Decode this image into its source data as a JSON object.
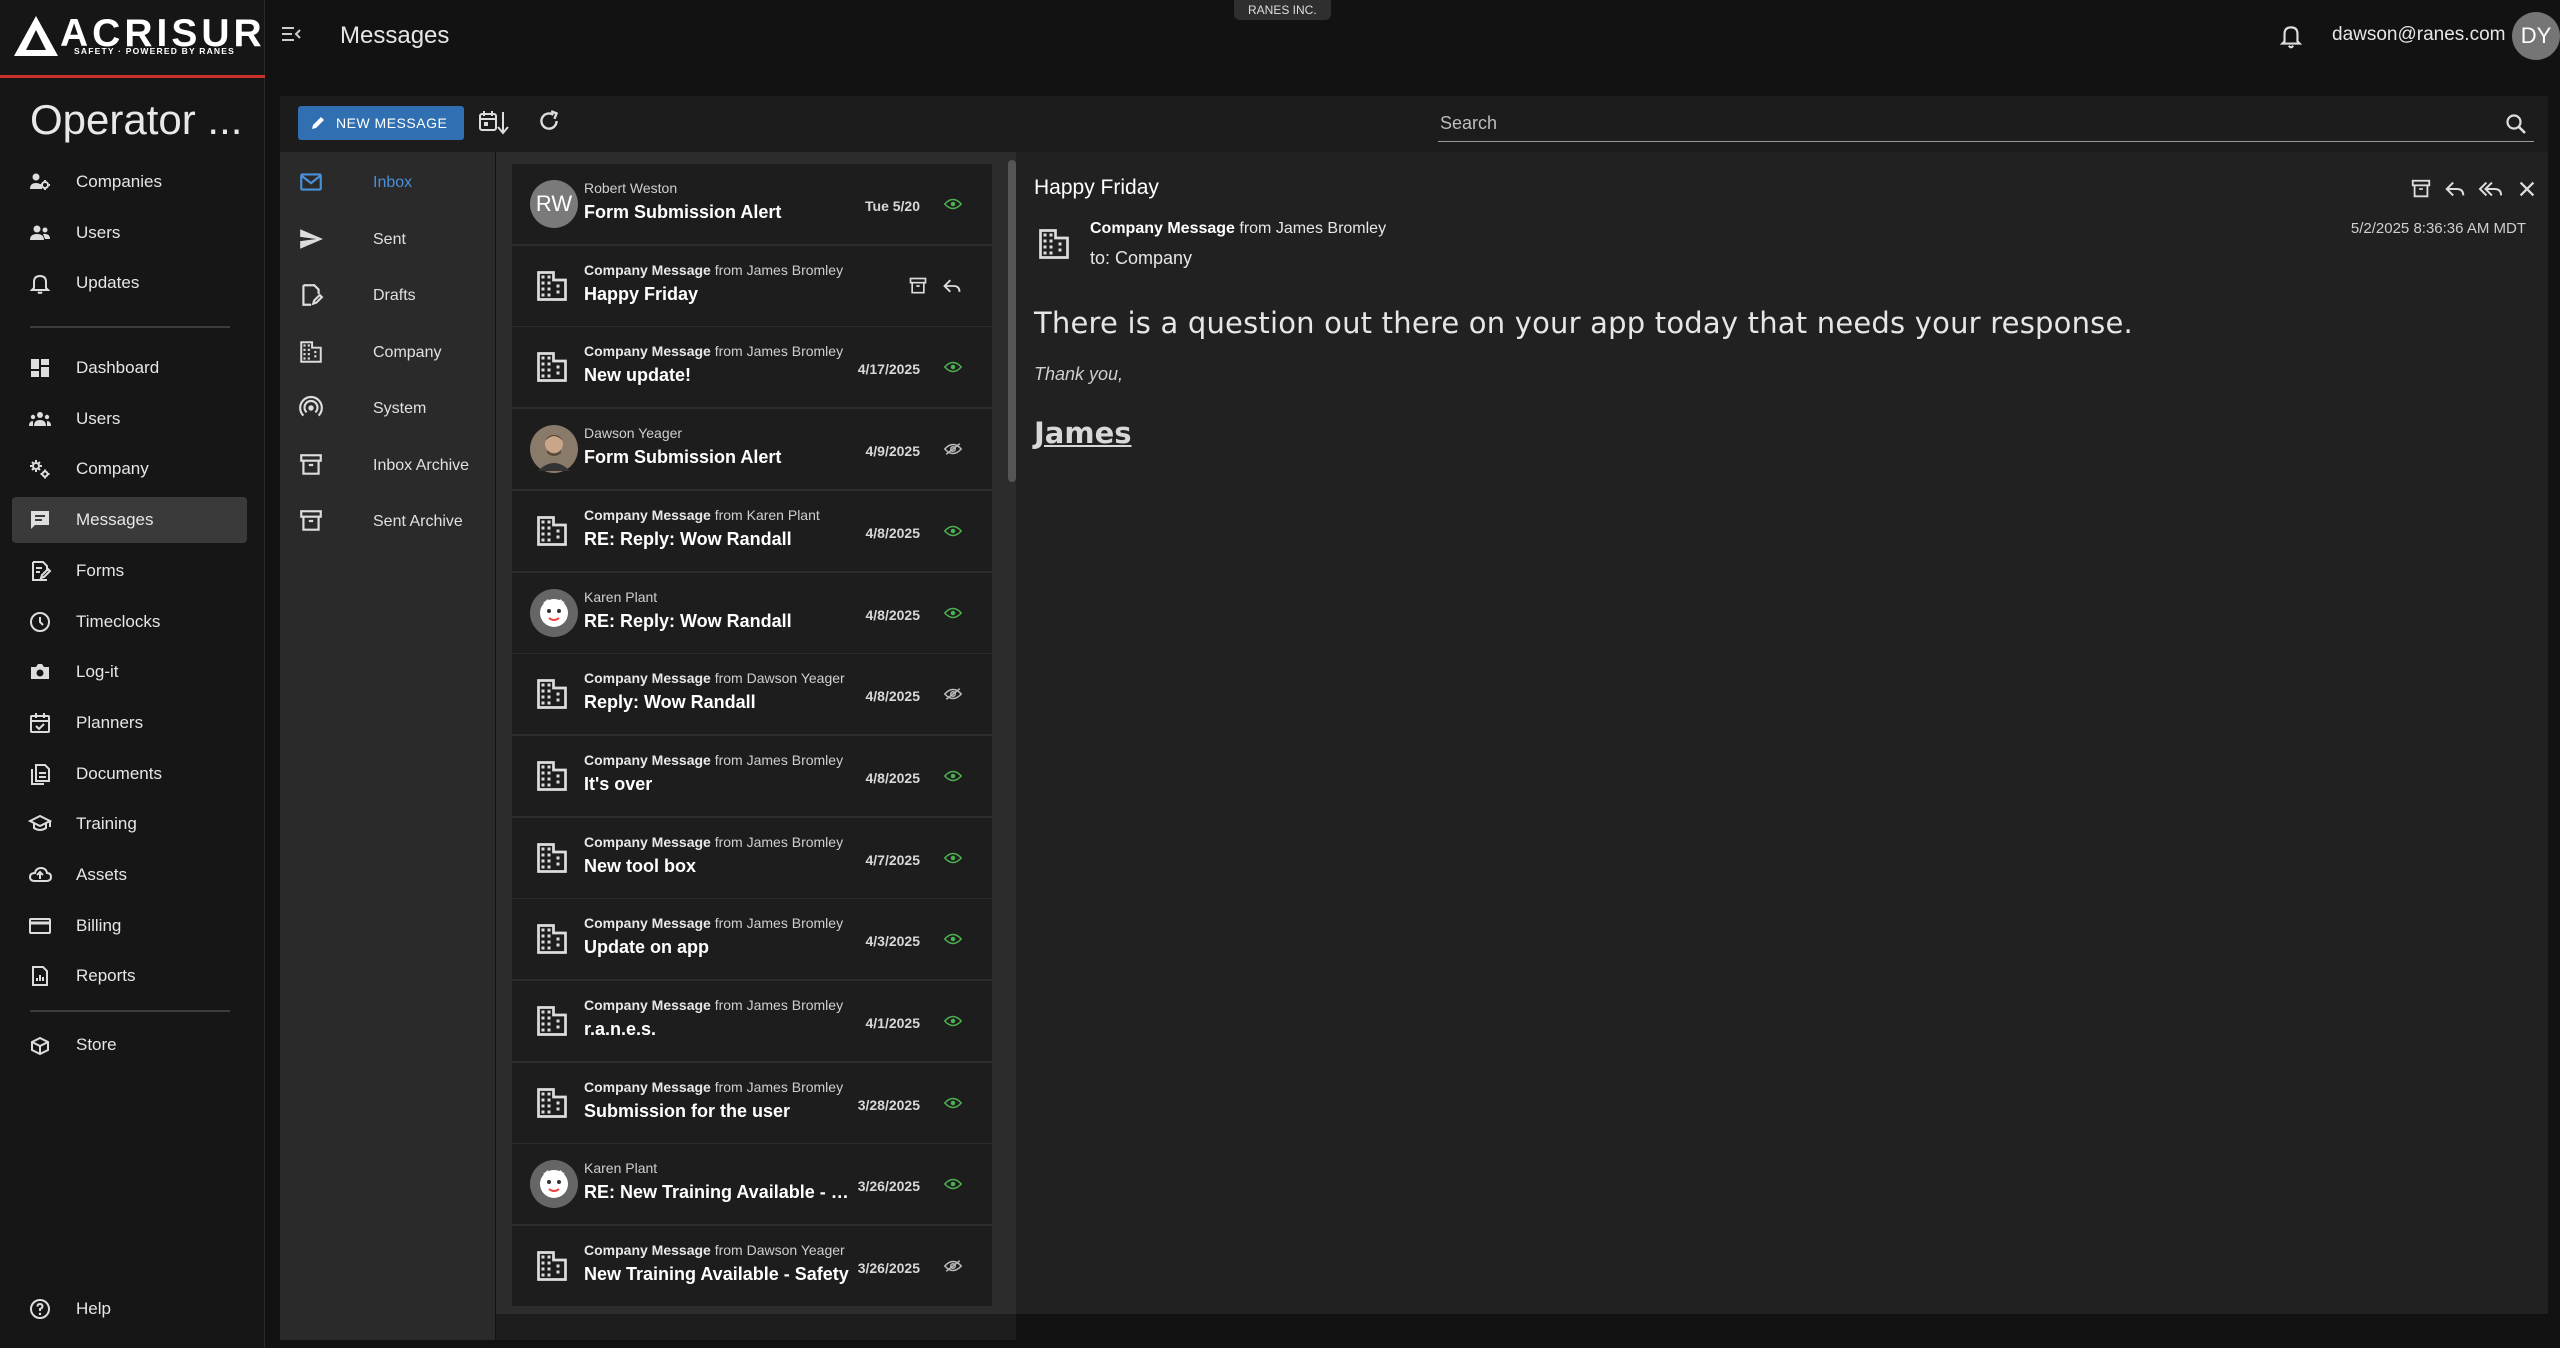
{
  "brand": {
    "name": "ACRISURE",
    "registered": "®",
    "tagline": "SAFETY · POWERED BY RANES"
  },
  "sidebar": {
    "org_title": "Operator ...",
    "group1": [
      {
        "label": "Companies",
        "icon": "companies-icon"
      },
      {
        "label": "Users",
        "icon": "users-icon"
      },
      {
        "label": "Updates",
        "icon": "bell-icon"
      }
    ],
    "group2": [
      {
        "label": "Dashboard",
        "icon": "dashboard-icon"
      },
      {
        "label": "Users",
        "icon": "users-group-icon"
      },
      {
        "label": "Company",
        "icon": "gears-icon"
      },
      {
        "label": "Messages",
        "icon": "message-icon",
        "active": true
      },
      {
        "label": "Forms",
        "icon": "forms-icon"
      },
      {
        "label": "Timeclocks",
        "icon": "clock-icon"
      },
      {
        "label": "Log-it",
        "icon": "camera-icon"
      },
      {
        "label": "Planners",
        "icon": "calendar-icon"
      },
      {
        "label": "Documents",
        "icon": "documents-icon"
      },
      {
        "label": "Training",
        "icon": "training-icon"
      },
      {
        "label": "Assets",
        "icon": "cloud-icon"
      },
      {
        "label": "Billing",
        "icon": "card-icon"
      },
      {
        "label": "Reports",
        "icon": "reports-icon"
      }
    ],
    "store": {
      "label": "Store",
      "icon": "store-icon"
    },
    "help": {
      "label": "Help",
      "icon": "help-icon"
    }
  },
  "header": {
    "title": "Messages",
    "org_badge": "RANES INC.",
    "user_email": "dawson@ranes.com",
    "user_initials": "DY"
  },
  "toolbar": {
    "new_message_label": "NEW MESSAGE",
    "search_placeholder": "Search"
  },
  "folders": [
    {
      "label": "Inbox",
      "icon": "mail-icon",
      "active": true
    },
    {
      "label": "Sent",
      "icon": "send-icon"
    },
    {
      "label": "Drafts",
      "icon": "drafts-icon"
    },
    {
      "label": "Company",
      "icon": "building-icon"
    },
    {
      "label": "System",
      "icon": "broadcast-icon"
    },
    {
      "label": "Inbox Archive",
      "icon": "archive-icon"
    },
    {
      "label": "Sent Archive",
      "icon": "archive-icon"
    }
  ],
  "messages": [
    {
      "type": "user",
      "initials": "RW",
      "from": "Robert Weston",
      "subject": "Form Submission Alert",
      "date": "Tue 5/20",
      "status": "read"
    },
    {
      "type": "company",
      "from_prefix": "Company Message",
      "from": " from James Bromley",
      "subject": "Happy Friday",
      "date": "",
      "status": "selected"
    },
    {
      "type": "company",
      "from_prefix": "Company Message",
      "from": " from James Bromley",
      "subject": "New update!",
      "date": "4/17/2025",
      "status": "read"
    },
    {
      "type": "photo",
      "from": "Dawson Yeager",
      "subject": "Form Submission Alert",
      "date": "4/9/2025",
      "status": "unread"
    },
    {
      "type": "company",
      "from_prefix": "Company Message",
      "from": " from Karen Plant",
      "subject": "RE: Reply: Wow Randall",
      "date": "4/8/2025",
      "status": "read"
    },
    {
      "type": "cartoon",
      "from": "Karen Plant",
      "subject": "RE: Reply: Wow Randall",
      "date": "4/8/2025",
      "status": "read"
    },
    {
      "type": "company",
      "from_prefix": "Company Message",
      "from": " from Dawson Yeager",
      "subject": "Reply: Wow Randall",
      "date": "4/8/2025",
      "status": "unread"
    },
    {
      "type": "company",
      "from_prefix": "Company Message",
      "from": " from James Bromley",
      "subject": "It's over",
      "date": "4/8/2025",
      "status": "read"
    },
    {
      "type": "company",
      "from_prefix": "Company Message",
      "from": " from James Bromley",
      "subject": "New tool box",
      "date": "4/7/2025",
      "status": "read"
    },
    {
      "type": "company",
      "from_prefix": "Company Message",
      "from": " from James Bromley",
      "subject": "Update on app",
      "date": "4/3/2025",
      "status": "read"
    },
    {
      "type": "company",
      "from_prefix": "Company Message",
      "from": " from James Bromley",
      "subject": "r.a.n.e.s.",
      "date": "4/1/2025",
      "status": "read"
    },
    {
      "type": "company",
      "from_prefix": "Company Message",
      "from": " from James Bromley",
      "subject": "Submission for the user",
      "date": "3/28/2025",
      "status": "read"
    },
    {
      "type": "cartoon",
      "from": "Karen Plant",
      "subject": "RE: New Training Available - Safety",
      "date": "3/26/2025",
      "status": "read"
    },
    {
      "type": "company",
      "from_prefix": "Company Message",
      "from": " from Dawson Yeager",
      "subject": "New Training Available - Safety",
      "date": "3/26/2025",
      "status": "unread"
    }
  ],
  "reader": {
    "subject": "Happy Friday",
    "from_prefix": "Company Message",
    "from_rest": " from James Bromley",
    "to": "to: Company",
    "timestamp": "5/2/2025 8:36:36 AM MDT",
    "body": "There is a question out there on your app today that needs your response.",
    "thanks": "Thank you,",
    "signature": "James"
  },
  "colors": {
    "accent": "#2f6fb2",
    "brand_red": "#c8322b",
    "read_green": "#4caf50",
    "active_blue": "#4a90d9"
  }
}
